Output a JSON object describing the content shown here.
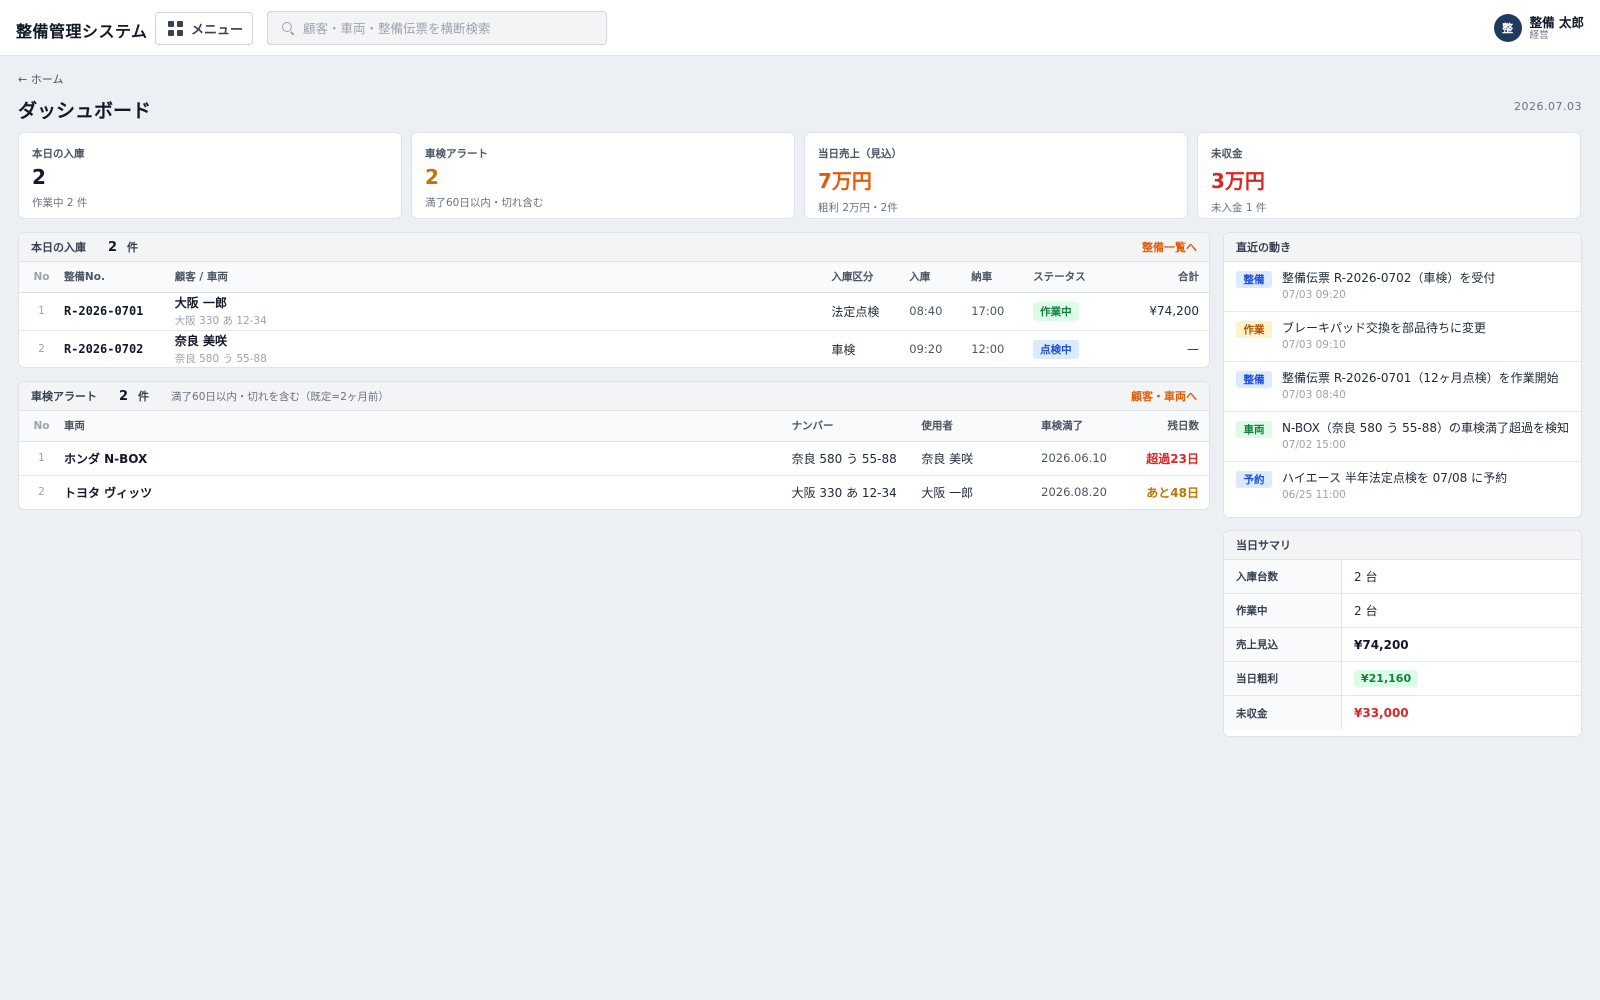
{
  "header": {
    "app_title": "整備管理システム",
    "menu_label": "メニュー",
    "search_placeholder": "顧客・車両・整備伝票を横断検索",
    "user": {
      "avatar": "整",
      "name": "整備 太郎",
      "role": "経営"
    }
  },
  "page": {
    "breadcrumb": "← ホーム",
    "title": "ダッシュボード",
    "date": "2026.07.03"
  },
  "colors": {
    "orange_link": "#e05d0a",
    "amber": "#c27500",
    "orange_value": "#e05d0a",
    "red": "#dc2626"
  },
  "kpis": [
    {
      "label": "本日の入庫",
      "value": "2",
      "sub": "作業中 2 件",
      "color": "#111827"
    },
    {
      "label": "車検アラート",
      "value": "2",
      "sub": "満了60日以内・切れ含む",
      "color": "#c27500"
    },
    {
      "label": "当日売上（見込）",
      "value": "7万円",
      "sub": "粗利 2万円・2件",
      "color": "#e05d0a"
    },
    {
      "label": "未収金",
      "value": "3万円",
      "sub": "未入金 1 件",
      "color": "#dc2626"
    }
  ],
  "today_panel": {
    "title": "本日の入庫",
    "count": "2",
    "unit": "件",
    "link": "整備一覧へ",
    "columns": [
      "No",
      "整備No.",
      "顧客 / 車両",
      "入庫区分",
      "入庫",
      "納車",
      "ステータス",
      "合計"
    ],
    "rows": [
      {
        "no": "1",
        "id": "R-2026-0701",
        "customer": "大阪 一郎",
        "vehicle": "大阪 330 あ 12-34",
        "type": "法定点検",
        "in": "08:40",
        "out": "17:00",
        "status": "作業中",
        "status_bg": "#dcfce7",
        "status_fg": "#15803d",
        "total": "¥74,200"
      },
      {
        "no": "2",
        "id": "R-2026-0702",
        "customer": "奈良 美咲",
        "vehicle": "奈良 580 う 55-88",
        "type": "車検",
        "in": "09:20",
        "out": "12:00",
        "status": "点検中",
        "status_bg": "#dbeafe",
        "status_fg": "#1d4ed8",
        "total": "—"
      }
    ]
  },
  "alert_panel": {
    "title": "車検アラート",
    "count": "2",
    "unit": "件",
    "note": "満了60日以内・切れを含む（既定=2ヶ月前）",
    "link": "顧客・車両へ",
    "columns": [
      "No",
      "車両",
      "ナンバー",
      "使用者",
      "車検満了",
      "残日数"
    ],
    "rows": [
      {
        "no": "1",
        "vehicle": "ホンダ N-BOX",
        "plate": "奈良 580 う 55-88",
        "user": "奈良 美咲",
        "expiry": "2026.06.10",
        "remaining": "超過23日",
        "color": "#dc2626"
      },
      {
        "no": "2",
        "vehicle": "トヨタ ヴィッツ",
        "plate": "大阪 330 あ 12-34",
        "user": "大阪 一郎",
        "expiry": "2026.08.20",
        "remaining": "あと48日",
        "color": "#c27500"
      }
    ]
  },
  "activity": {
    "title": "直近の動き",
    "items": [
      {
        "tag": "整備",
        "tag_bg": "#dbeafe",
        "tag_fg": "#1d4ed8",
        "text": "整備伝票 R-2026-0702（車検）を受付",
        "time": "07/03 09:20"
      },
      {
        "tag": "作業",
        "tag_bg": "#fef3c7",
        "tag_fg": "#b45309",
        "text": "ブレーキパッド交換を部品待ちに変更",
        "time": "07/03 09:10"
      },
      {
        "tag": "整備",
        "tag_bg": "#dbeafe",
        "tag_fg": "#1d4ed8",
        "text": "整備伝票 R-2026-0701（12ヶ月点検）を作業開始",
        "time": "07/03 08:40"
      },
      {
        "tag": "車両",
        "tag_bg": "#dcfce7",
        "tag_fg": "#15803d",
        "text": "N-BOX（奈良 580 う 55-88）の車検満了超過を検知",
        "time": "07/02 15:00"
      },
      {
        "tag": "予約",
        "tag_bg": "#dbeafe",
        "tag_fg": "#1d4ed8",
        "text": "ハイエース 半年法定点検を 07/08 に予約",
        "time": "06/25 11:00"
      }
    ]
  },
  "summary": {
    "title": "当日サマリ",
    "rows": [
      {
        "label": "入庫台数",
        "value": "2 台",
        "style": "plain"
      },
      {
        "label": "作業中",
        "value": "2 台",
        "style": "plain"
      },
      {
        "label": "売上見込",
        "value": "¥74,200",
        "style": "bold"
      },
      {
        "label": "当日粗利",
        "value": "¥21,160",
        "style": "green-badge"
      },
      {
        "label": "未収金",
        "value": "¥33,000",
        "style": "red"
      }
    ]
  }
}
